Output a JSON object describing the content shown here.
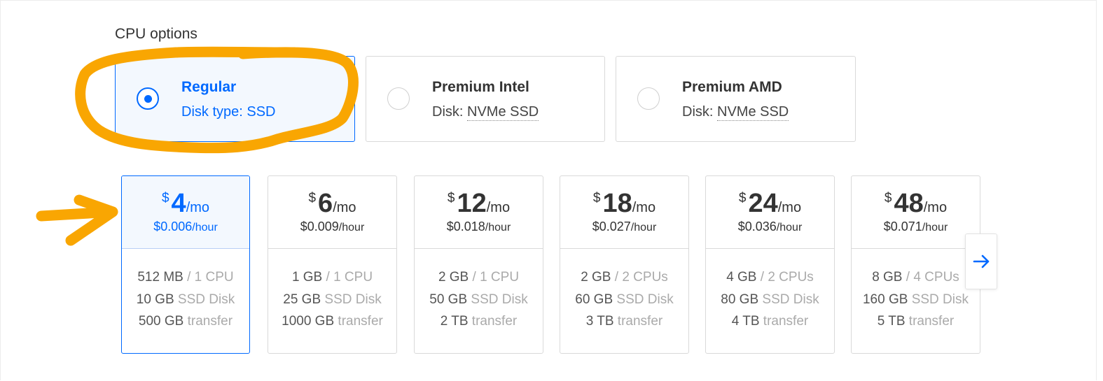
{
  "section": {
    "title": "CPU options"
  },
  "cpu_options": [
    {
      "name": "Regular",
      "disk_label": "Disk type: SSD",
      "disk_value": "",
      "selected": true
    },
    {
      "name": "Premium Intel",
      "disk_label": "Disk: ",
      "disk_value": "NVMe SSD",
      "selected": false
    },
    {
      "name": "Premium AMD",
      "disk_label": "Disk: ",
      "disk_value": "NVMe SSD",
      "selected": false
    }
  ],
  "plans": [
    {
      "dollar": "$",
      "amount": "4",
      "per": "/mo",
      "hourly": "$0.006",
      "hour_unit": "/hour",
      "memory": "512 MB",
      "cpu": " / 1 CPU",
      "disk": "10 GB",
      "disk_unit": " SSD Disk",
      "transfer": "500 GB",
      "transfer_unit": " transfer",
      "selected": true
    },
    {
      "dollar": "$",
      "amount": "6",
      "per": "/mo",
      "hourly": "$0.009",
      "hour_unit": "/hour",
      "memory": "1 GB",
      "cpu": " / 1 CPU",
      "disk": "25 GB",
      "disk_unit": " SSD Disk",
      "transfer": "1000 GB",
      "transfer_unit": " transfer",
      "selected": false
    },
    {
      "dollar": "$",
      "amount": "12",
      "per": "/mo",
      "hourly": "$0.018",
      "hour_unit": "/hour",
      "memory": "2 GB",
      "cpu": " / 1 CPU",
      "disk": "50 GB",
      "disk_unit": " SSD Disk",
      "transfer": "2 TB",
      "transfer_unit": " transfer",
      "selected": false
    },
    {
      "dollar": "$",
      "amount": "18",
      "per": "/mo",
      "hourly": "$0.027",
      "hour_unit": "/hour",
      "memory": "2 GB",
      "cpu": " / 2 CPUs",
      "disk": "60 GB",
      "disk_unit": " SSD Disk",
      "transfer": "3 TB",
      "transfer_unit": " transfer",
      "selected": false
    },
    {
      "dollar": "$",
      "amount": "24",
      "per": "/mo",
      "hourly": "$0.036",
      "hour_unit": "/hour",
      "memory": "4 GB",
      "cpu": " / 2 CPUs",
      "disk": "80 GB",
      "disk_unit": " SSD Disk",
      "transfer": "4 TB",
      "transfer_unit": " transfer",
      "selected": false
    },
    {
      "dollar": "$",
      "amount": "48",
      "per": "/mo",
      "hourly": "$0.071",
      "hour_unit": "/hour",
      "memory": "8 GB",
      "cpu": " / 4 CPUs",
      "disk": "160 GB",
      "disk_unit": " SSD Disk",
      "transfer": "5 TB",
      "transfer_unit": " transfer",
      "selected": false
    }
  ],
  "icons": {
    "next": "arrow-right-icon"
  },
  "colors": {
    "accent": "#0069ff",
    "annotation": "#f9a602",
    "selected_bg": "#f3f8fe"
  }
}
